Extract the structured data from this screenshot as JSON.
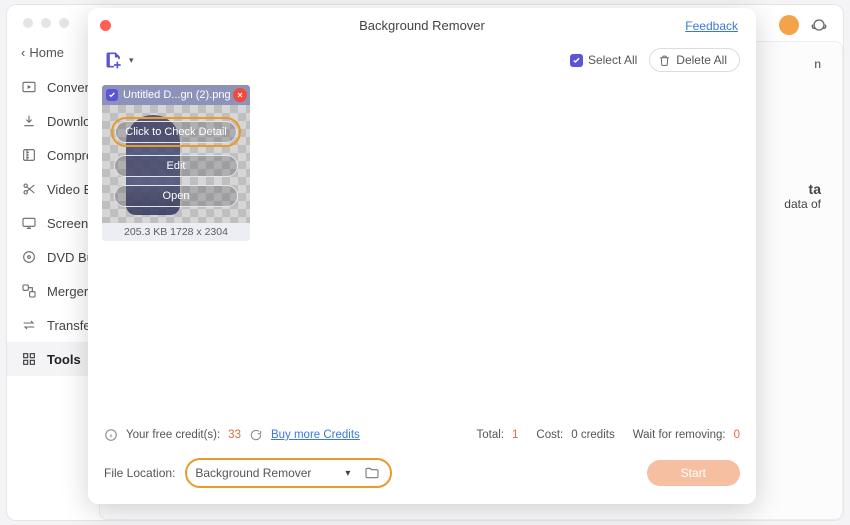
{
  "sidebar": {
    "home": "Home",
    "items": [
      {
        "label": "Converter"
      },
      {
        "label": "Downloader"
      },
      {
        "label": "Compressor"
      },
      {
        "label": "Video Editor"
      },
      {
        "label": "Screen Recorder"
      },
      {
        "label": "DVD Burner"
      },
      {
        "label": "Merger"
      },
      {
        "label": "Transfer"
      },
      {
        "label": "Tools"
      }
    ]
  },
  "bg_peek": {
    "line1": "n",
    "line2": "ta",
    "line3": "data of"
  },
  "modal": {
    "title": "Background Remover",
    "feedback": "Feedback",
    "select_all": "Select All",
    "delete_all": "Delete All"
  },
  "thumb": {
    "filename": "Untitled D...gn (2).png",
    "check_detail": "Click to Check Detail",
    "edit": "Edit",
    "open": "Open",
    "meta": "205.3 KB 1728 x 2304"
  },
  "credits": {
    "label": "Your free credit(s):",
    "count": "33",
    "buy_more": "Buy more Credits",
    "total_label": "Total:",
    "total": "1",
    "cost_label": "Cost:",
    "cost": "0 credits",
    "wait_label": "Wait for removing:",
    "wait": "0"
  },
  "location": {
    "label": "File Location:",
    "value": "Background Remover",
    "start": "Start"
  }
}
